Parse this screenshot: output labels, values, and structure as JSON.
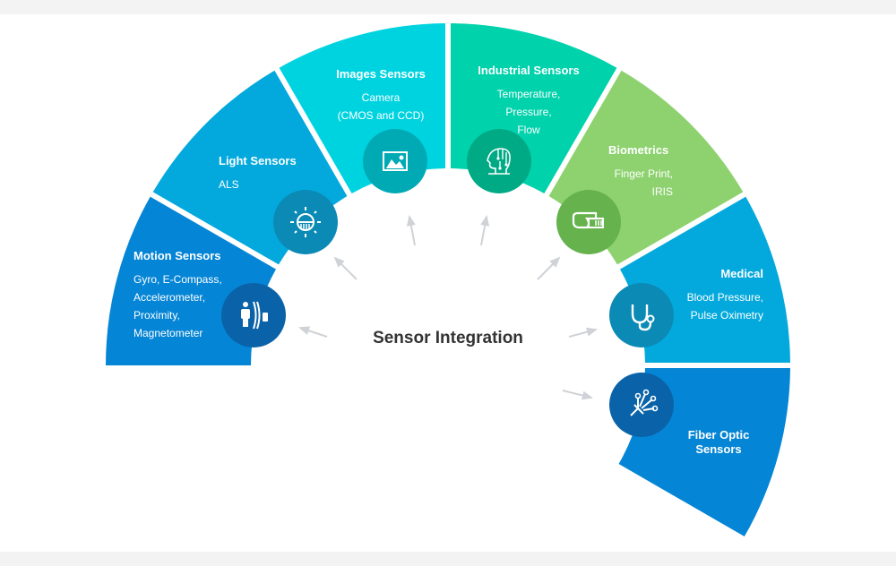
{
  "title": "Sensor Integration",
  "segments": [
    {
      "id": "motion",
      "title": "Motion Sensors",
      "lines": [
        "Gyro,  E-Compass,",
        "Accelerometer,",
        "Proximity,",
        "Magnetometer"
      ],
      "icon": "person-proximity-icon",
      "color": "#0585d5",
      "circle": "#0a63a8"
    },
    {
      "id": "light",
      "title": "Light Sensors",
      "lines": [
        "ALS"
      ],
      "icon": "light-bulb-sun-icon",
      "color": "#03a9dd",
      "circle": "#0b8ab5"
    },
    {
      "id": "images",
      "title": "Images Sensors",
      "lines": [
        "Camera",
        "(CMOS and CCD)"
      ],
      "icon": "image-icon",
      "color": "#00d3e0",
      "circle": "#00aab5"
    },
    {
      "id": "industrial",
      "title": "Industrial Sensors",
      "lines": [
        "Temperature,",
        "Pressure,",
        "Flow"
      ],
      "icon": "ai-head-icon",
      "color": "#00d2ac",
      "circle": "#00aa85"
    },
    {
      "id": "biometrics",
      "title": "Biometrics",
      "lines": [
        "Finger Print,",
        "IRIS"
      ],
      "icon": "fingerprint-scan-icon",
      "color": "#8ed270",
      "circle": "#66b24d"
    },
    {
      "id": "medical",
      "title": "Medical",
      "lines": [
        "Blood Pressure,",
        "Pulse Oximetry"
      ],
      "icon": "stethoscope-icon",
      "color": "#03a9dd",
      "circle": "#0b8ab5"
    },
    {
      "id": "fiber",
      "title": "Fiber Optic",
      "lines": [
        "Sensors"
      ],
      "icon": "fiber-optic-icon",
      "color": "#0585d5",
      "circle": "#0a63a8"
    }
  ],
  "colors": {
    "arrow": "#cfd2d6",
    "title": "#333333",
    "background": "#f3f3f3"
  }
}
